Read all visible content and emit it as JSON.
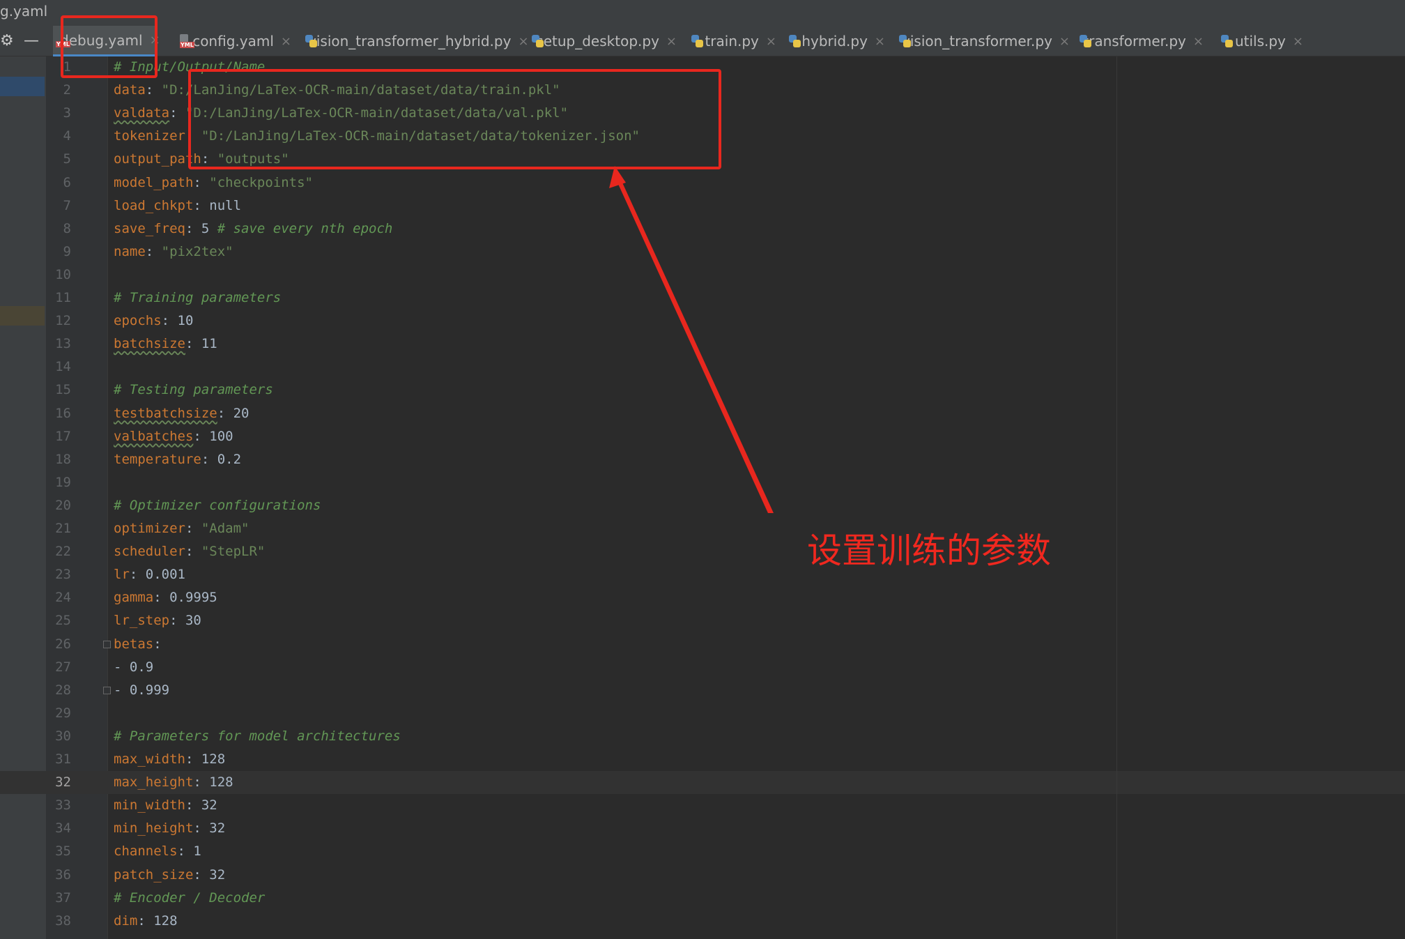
{
  "window": {
    "title": "g.yaml"
  },
  "tabs": [
    {
      "label": "debug.yaml",
      "icon": "yaml-file-icon",
      "active": true
    },
    {
      "label": "config.yaml",
      "icon": "yaml-file-icon"
    },
    {
      "label": "vision_transformer_hybrid.py",
      "icon": "python-file-icon"
    },
    {
      "label": "setup_desktop.py",
      "icon": "python-file-icon"
    },
    {
      "label": "train.py",
      "icon": "python-file-icon"
    },
    {
      "label": "hybrid.py",
      "icon": "python-file-icon"
    },
    {
      "label": "vision_transformer.py",
      "icon": "python-file-icon"
    },
    {
      "label": "transformer.py",
      "icon": "python-file-icon"
    },
    {
      "label": "utils.py",
      "icon": "python-file-icon"
    }
  ],
  "tab_close_glyph": "×",
  "tool_icons": {
    "settings": "⚙",
    "minimize": "—"
  },
  "editor": {
    "current_line": 32,
    "lines": [
      {
        "n": "1",
        "tokens": [
          {
            "t": "# Input/Output/Name",
            "c": "c"
          }
        ]
      },
      {
        "n": "2",
        "tokens": [
          {
            "t": "data",
            "c": "k"
          },
          {
            "t": ": ",
            "c": "n"
          },
          {
            "t": "\"D:/LanJing/LaTex-OCR-main/dataset/data/train.pkl\"",
            "c": "s"
          }
        ]
      },
      {
        "n": "3",
        "tokens": [
          {
            "t": "valdata",
            "c": "k",
            "wavy": true
          },
          {
            "t": ": ",
            "c": "n"
          },
          {
            "t": "\"D:/LanJing/LaTex-OCR-main/dataset/data/val.pkl\"",
            "c": "s"
          }
        ]
      },
      {
        "n": "4",
        "tokens": [
          {
            "t": "tokenizer",
            "c": "k"
          },
          {
            "t": ": ",
            "c": "n"
          },
          {
            "t": "\"D:/LanJing/LaTex-OCR-main/dataset/data/tokenizer.json\"",
            "c": "s"
          }
        ]
      },
      {
        "n": "5",
        "tokens": [
          {
            "t": "output_path",
            "c": "k"
          },
          {
            "t": ": ",
            "c": "n"
          },
          {
            "t": "\"outputs\"",
            "c": "s"
          }
        ]
      },
      {
        "n": "6",
        "tokens": [
          {
            "t": "model_path",
            "c": "k"
          },
          {
            "t": ": ",
            "c": "n"
          },
          {
            "t": "\"checkpoints\"",
            "c": "s"
          }
        ]
      },
      {
        "n": "7",
        "tokens": [
          {
            "t": "load_chkpt",
            "c": "k"
          },
          {
            "t": ": null",
            "c": "n"
          }
        ]
      },
      {
        "n": "8",
        "tokens": [
          {
            "t": "save_freq",
            "c": "k"
          },
          {
            "t": ": 5 ",
            "c": "n"
          },
          {
            "t": "# save every nth epoch",
            "c": "c"
          }
        ]
      },
      {
        "n": "9",
        "tokens": [
          {
            "t": "name",
            "c": "k"
          },
          {
            "t": ": ",
            "c": "n"
          },
          {
            "t": "\"pix2tex\"",
            "c": "s"
          }
        ]
      },
      {
        "n": "10",
        "tokens": []
      },
      {
        "n": "11",
        "tokens": [
          {
            "t": "# Training parameters",
            "c": "c"
          }
        ]
      },
      {
        "n": "12",
        "tokens": [
          {
            "t": "epochs",
            "c": "k"
          },
          {
            "t": ": 10",
            "c": "n"
          }
        ]
      },
      {
        "n": "13",
        "tokens": [
          {
            "t": "batchsize",
            "c": "k",
            "wavy": true
          },
          {
            "t": ": 11",
            "c": "n"
          }
        ]
      },
      {
        "n": "14",
        "tokens": []
      },
      {
        "n": "15",
        "tokens": [
          {
            "t": "# Testing parameters",
            "c": "c"
          }
        ]
      },
      {
        "n": "16",
        "tokens": [
          {
            "t": "testbatchsize",
            "c": "k",
            "wavy": true
          },
          {
            "t": ": 20",
            "c": "n"
          }
        ]
      },
      {
        "n": "17",
        "tokens": [
          {
            "t": "valbatches",
            "c": "k",
            "wavy": true
          },
          {
            "t": ": 100",
            "c": "n"
          }
        ]
      },
      {
        "n": "18",
        "tokens": [
          {
            "t": "temperature",
            "c": "k"
          },
          {
            "t": ": 0.2",
            "c": "n"
          }
        ]
      },
      {
        "n": "19",
        "tokens": []
      },
      {
        "n": "20",
        "tokens": [
          {
            "t": "# Optimizer configurations",
            "c": "c"
          }
        ]
      },
      {
        "n": "21",
        "tokens": [
          {
            "t": "optimizer",
            "c": "k"
          },
          {
            "t": ": ",
            "c": "n"
          },
          {
            "t": "\"Adam\"",
            "c": "s"
          }
        ]
      },
      {
        "n": "22",
        "tokens": [
          {
            "t": "scheduler",
            "c": "k"
          },
          {
            "t": ": ",
            "c": "n"
          },
          {
            "t": "\"StepLR\"",
            "c": "s"
          }
        ]
      },
      {
        "n": "23",
        "tokens": [
          {
            "t": "lr",
            "c": "k"
          },
          {
            "t": ": 0.001",
            "c": "n"
          }
        ]
      },
      {
        "n": "24",
        "tokens": [
          {
            "t": "gamma",
            "c": "k"
          },
          {
            "t": ": 0.9995",
            "c": "n"
          }
        ]
      },
      {
        "n": "25",
        "tokens": [
          {
            "t": "lr_step",
            "c": "k"
          },
          {
            "t": ": 30",
            "c": "n"
          }
        ]
      },
      {
        "n": "26",
        "tokens": [
          {
            "t": "betas",
            "c": "k"
          },
          {
            "t": ":",
            "c": "n"
          }
        ]
      },
      {
        "n": "27",
        "tokens": [
          {
            "t": "- 0.9",
            "c": "n"
          }
        ]
      },
      {
        "n": "28",
        "tokens": [
          {
            "t": "- 0.999",
            "c": "n"
          }
        ]
      },
      {
        "n": "29",
        "tokens": []
      },
      {
        "n": "30",
        "tokens": [
          {
            "t": "# Parameters for model architectures",
            "c": "c"
          }
        ]
      },
      {
        "n": "31",
        "tokens": [
          {
            "t": "max_width",
            "c": "k"
          },
          {
            "t": ": 128",
            "c": "n"
          }
        ]
      },
      {
        "n": "32",
        "tokens": [
          {
            "t": "max_height",
            "c": "k"
          },
          {
            "t": ": 128",
            "c": "n"
          }
        ]
      },
      {
        "n": "33",
        "tokens": [
          {
            "t": "min_width",
            "c": "k"
          },
          {
            "t": ": 32",
            "c": "n"
          }
        ]
      },
      {
        "n": "34",
        "tokens": [
          {
            "t": "min_height",
            "c": "k"
          },
          {
            "t": ": 32",
            "c": "n"
          }
        ]
      },
      {
        "n": "35",
        "tokens": [
          {
            "t": "channels",
            "c": "k"
          },
          {
            "t": ": 1",
            "c": "n"
          }
        ]
      },
      {
        "n": "36",
        "tokens": [
          {
            "t": "patch_size",
            "c": "k"
          },
          {
            "t": ": 32",
            "c": "n"
          }
        ]
      },
      {
        "n": "37",
        "tokens": [
          {
            "t": "# Encoder / Decoder",
            "c": "c"
          }
        ]
      },
      {
        "n": "38",
        "tokens": [
          {
            "t": "dim",
            "c": "k"
          },
          {
            "t": ": 128",
            "c": "n"
          }
        ]
      }
    ]
  },
  "annotation": {
    "text": "设置训练的参数",
    "color": "#e8271e"
  },
  "colors": {
    "key": "#cc7832",
    "string": "#6a8759",
    "comment": "#629755",
    "text": "#a9b7c6",
    "background": "#2b2b2b"
  }
}
